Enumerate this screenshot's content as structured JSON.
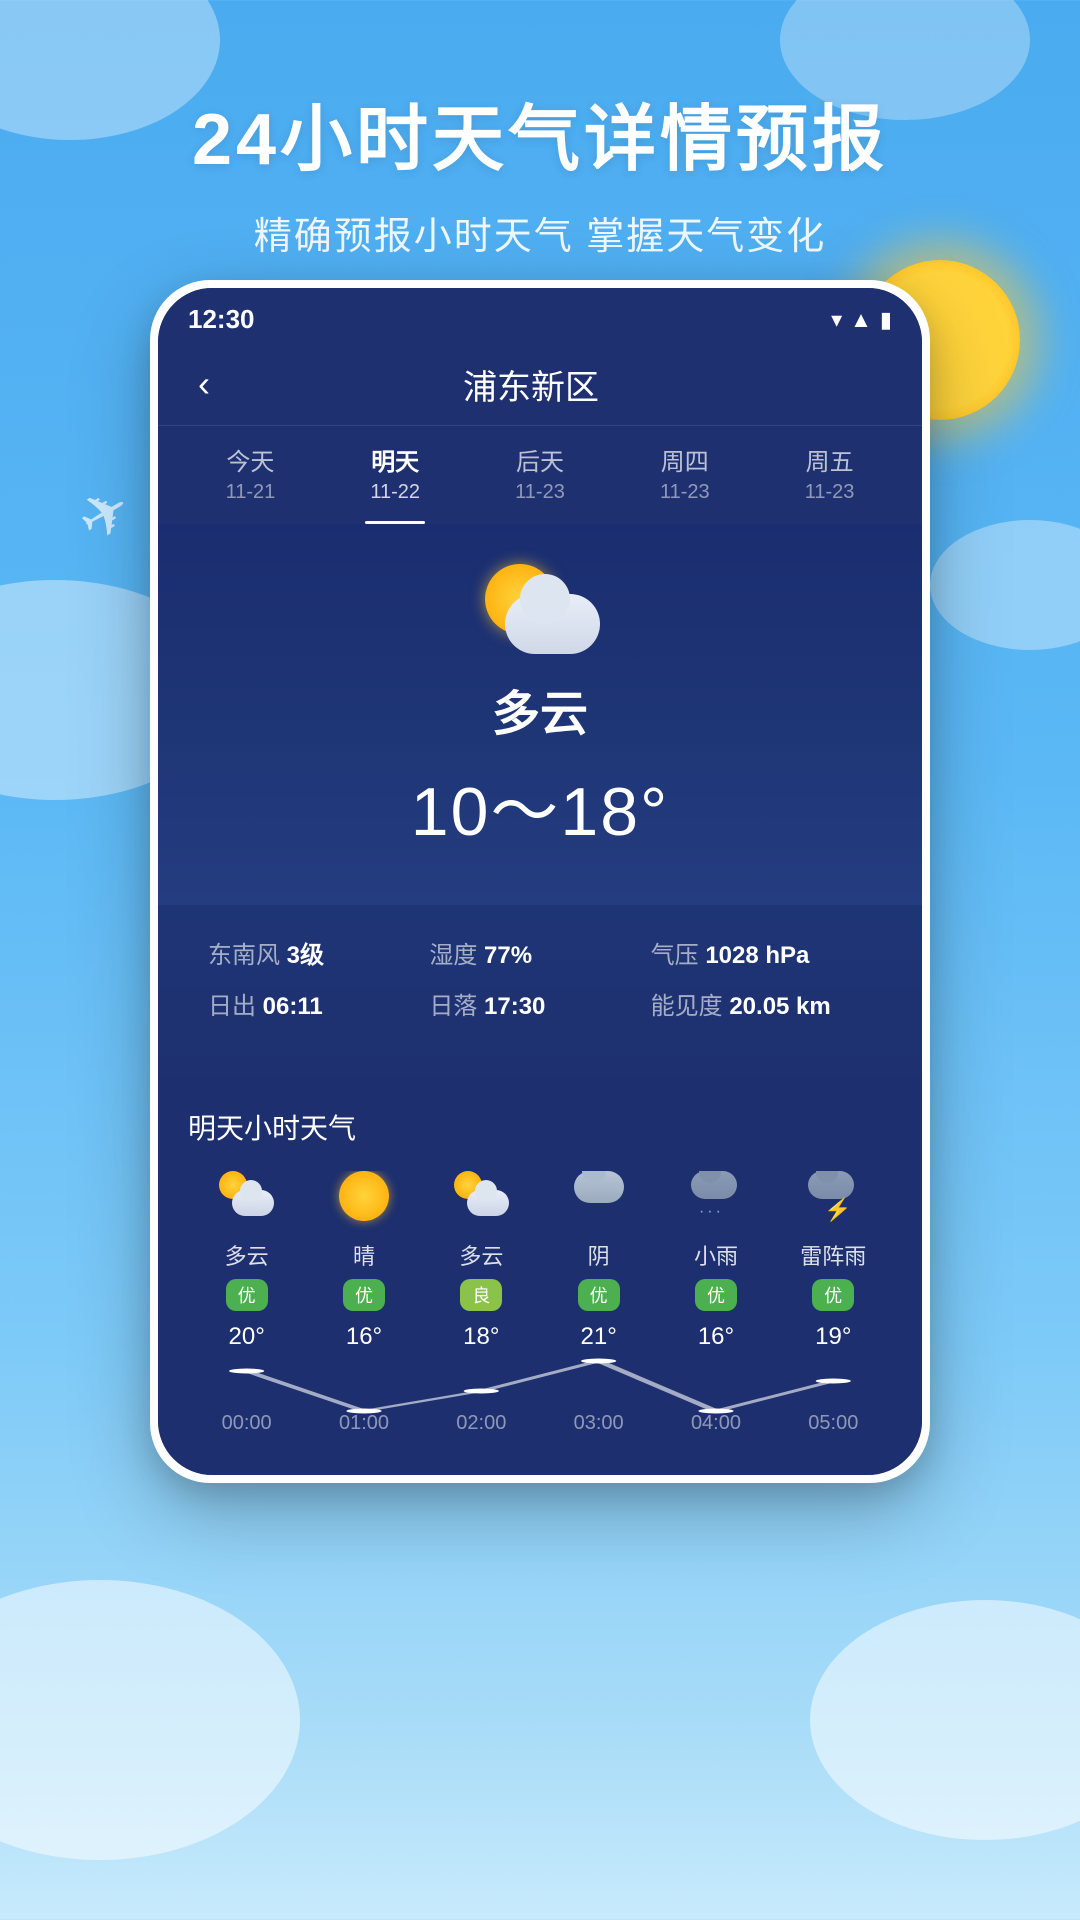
{
  "header": {
    "main_title": "24小时天气详情预报",
    "sub_title": "精确预报小时天气 掌握天气变化"
  },
  "status_bar": {
    "time": "12:30"
  },
  "nav": {
    "city": "浦东新区",
    "back_label": "‹"
  },
  "day_tabs": [
    {
      "label": "今天",
      "date": "11-21",
      "active": false
    },
    {
      "label": "明天",
      "date": "11-22",
      "active": true
    },
    {
      "label": "后天",
      "date": "11-23",
      "active": false
    },
    {
      "label": "周四",
      "date": "11-23",
      "active": false
    },
    {
      "label": "周五",
      "date": "11-23",
      "active": false
    }
  ],
  "weather_main": {
    "condition": "多云",
    "temp_range": "10～18°"
  },
  "weather_details": {
    "row1": [
      {
        "label": "东南风 ",
        "value": "3级"
      },
      {
        "label": "湿度 ",
        "value": "77%"
      },
      {
        "label": "气压 ",
        "value": "1028 hPa"
      }
    ],
    "row2": [
      {
        "label": "日出 ",
        "value": "06:11"
      },
      {
        "label": "日落 ",
        "value": "17:30"
      },
      {
        "label": "能见度 ",
        "value": "20.05 km"
      }
    ]
  },
  "hourly_section": {
    "title": "明天小时天气",
    "items": [
      {
        "icon": "sun-cloud",
        "condition": "多云",
        "air_quality": "优",
        "aq_class": "aq-good",
        "temp": "20°",
        "hour": "00:00"
      },
      {
        "icon": "sun",
        "condition": "晴",
        "air_quality": "优",
        "aq_class": "aq-good",
        "temp": "16°",
        "hour": "01:00"
      },
      {
        "icon": "sun-cloud",
        "condition": "多云",
        "air_quality": "良",
        "aq_class": "aq-moderate",
        "temp": "18°",
        "hour": "02:00"
      },
      {
        "icon": "cloud",
        "condition": "阴",
        "air_quality": "优",
        "aq_class": "aq-good",
        "temp": "21°",
        "hour": "03:00"
      },
      {
        "icon": "rain",
        "condition": "小雨",
        "air_quality": "优",
        "aq_class": "aq-good",
        "temp": "16°",
        "hour": "04:00"
      },
      {
        "icon": "thunder",
        "condition": "雷阵雨",
        "air_quality": "优",
        "aq_class": "aq-good",
        "temp": "19°",
        "hour": "05:00"
      }
    ],
    "graph_points": [
      {
        "x": 8.33,
        "y": 20
      },
      {
        "x": 25,
        "y": 60
      },
      {
        "x": 41.66,
        "y": 40
      },
      {
        "x": 58.33,
        "y": 10
      },
      {
        "x": 75,
        "y": 60
      },
      {
        "x": 91.66,
        "y": 30
      }
    ]
  },
  "colors": {
    "accent_blue": "#3b8fe0",
    "dark_navy": "#1a2d70",
    "light_blue": "#5bb8f5"
  }
}
